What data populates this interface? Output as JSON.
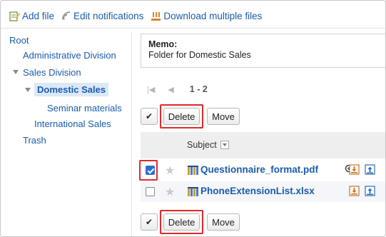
{
  "toolbar": {
    "add_file": "Add file",
    "edit_notifications": "Edit notifications",
    "download_multiple": "Download multiple files"
  },
  "tree": {
    "root": "Root",
    "administrative": "Administrative Division",
    "sales": "Sales Division",
    "domestic": "Domestic Sales",
    "seminar": "Seminar materials",
    "international": "International Sales",
    "trash": "Trash"
  },
  "memo": {
    "label": "Memo:",
    "text": "Folder for Domestic Sales"
  },
  "pager": {
    "first": "|◀",
    "prev": "◀",
    "range": "1 - 2"
  },
  "actions": {
    "check_glyph": "✔",
    "delete": "Delete",
    "move": "Move"
  },
  "table": {
    "subject_header": "Subject",
    "files": [
      {
        "name": "Questionnaire_format.pdf",
        "checked": true
      },
      {
        "name": "PhoneExtensionList.xlsx",
        "checked": false
      }
    ]
  },
  "colors": {
    "link": "#1a5bb0",
    "highlight": "#e0292b",
    "selected_bg": "#dbe9f6"
  }
}
